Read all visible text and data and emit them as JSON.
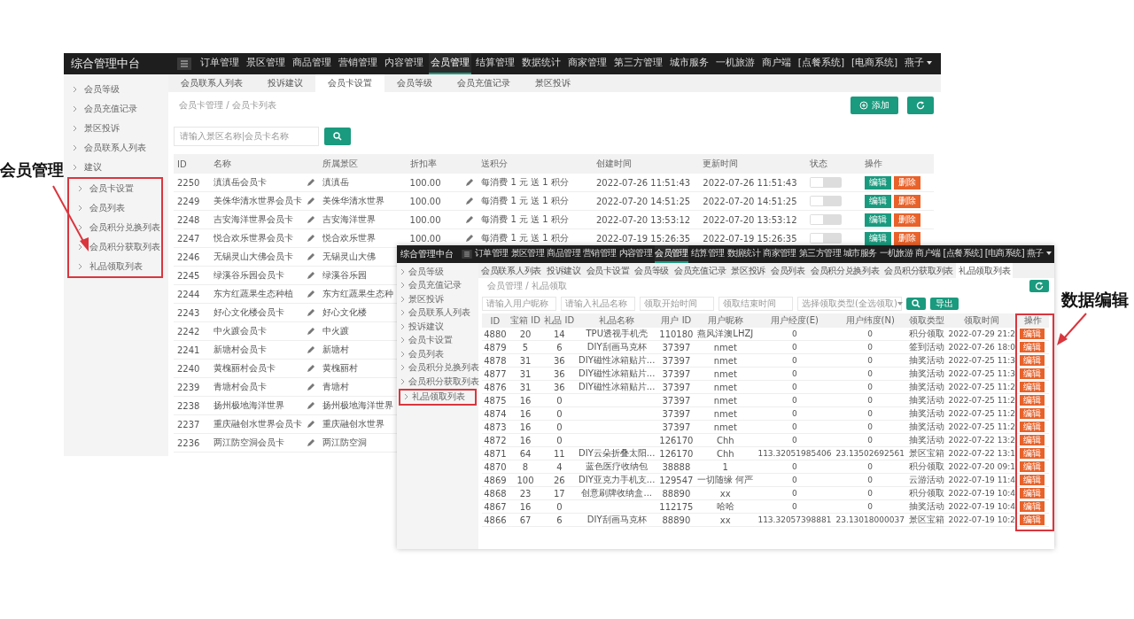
{
  "callouts": [
    {
      "text": "会员管理"
    },
    {
      "text": "数据编辑"
    }
  ],
  "back_window": {
    "title": "综合管理中台",
    "nav": [
      {
        "label": "订单管理",
        "selected": false
      },
      {
        "label": "景区管理",
        "selected": false
      },
      {
        "label": "商品管理",
        "selected": false
      },
      {
        "label": "营销管理",
        "selected": false
      },
      {
        "label": "内容管理",
        "selected": false
      },
      {
        "label": "会员管理",
        "selected": true
      },
      {
        "label": "结算管理",
        "selected": false
      },
      {
        "label": "数据统计",
        "selected": false
      },
      {
        "label": "商家管理",
        "selected": false
      },
      {
        "label": "第三方管理",
        "selected": false
      },
      {
        "label": "城市服务",
        "selected": false
      },
      {
        "label": "一机旅游",
        "selected": false
      },
      {
        "label": "商户端",
        "selected": false
      },
      {
        "label": "[点餐系统]",
        "selected": false
      },
      {
        "label": "[电商系统]",
        "selected": false
      }
    ],
    "user": "燕子",
    "tabs": [
      {
        "label": "会员联系人列表",
        "selected": false
      },
      {
        "label": "投诉建议",
        "selected": false
      },
      {
        "label": "会员卡设置",
        "selected": true
      },
      {
        "label": "会员等级",
        "selected": false
      },
      {
        "label": "会员充值记录",
        "selected": false
      },
      {
        "label": "景区投诉",
        "selected": false
      }
    ],
    "sidebar": [
      {
        "label": "会员等级",
        "boxed": false
      },
      {
        "label": "会员充值记录",
        "boxed": false
      },
      {
        "label": "景区投诉",
        "boxed": false
      },
      {
        "label": "会员联系人列表",
        "boxed": false
      },
      {
        "label": "建议",
        "boxed": false
      },
      {
        "label": "会员卡设置",
        "boxed": true
      },
      {
        "label": "会员列表",
        "boxed": true
      },
      {
        "label": "会员积分兑换列表",
        "boxed": true
      },
      {
        "label": "会员积分获取列表",
        "boxed": true
      },
      {
        "label": "礼品领取列表",
        "boxed": true
      }
    ],
    "breadcrumb": "会员卡管理 / 会员卡列表",
    "search": {
      "placeholder": "请输入景区名称|会员卡名称"
    },
    "add_button": "添加",
    "table": {
      "columns": [
        "ID",
        "名称",
        "所属景区",
        "折扣率",
        "送积分",
        "创建时间",
        "更新时间",
        "状态",
        "操作"
      ],
      "rows": [
        {
          "id": "2250",
          "name": "滇滇岳会员卡",
          "scenic": "滇滇岳",
          "discount": "100.00",
          "points": "每消费 1 元 送 1 积分",
          "created": "2022-07-26 11:51:43",
          "updated": "2022-07-26 11:51:43",
          "status": {
            "on": false
          },
          "actions": [
            "编辑",
            "删除"
          ]
        },
        {
          "id": "2249",
          "name": "美侏华清水世界会员卡",
          "scenic": "美侏华清水世界",
          "discount": "100.00",
          "points": "每消费 1 元 送 1 积分",
          "created": "2022-07-20 14:51:25",
          "updated": "2022-07-20 14:51:25",
          "status": {
            "on": false
          },
          "actions": [
            "编辑",
            "删除"
          ]
        },
        {
          "id": "2248",
          "name": "吉安海洋世界会员卡",
          "scenic": "吉安海洋世界",
          "discount": "100.00",
          "points": "每消费 1 元 送 1 积分",
          "created": "2022-07-20 13:53:12",
          "updated": "2022-07-20 13:53:12",
          "status": {
            "on": false
          },
          "actions": [
            "编辑",
            "删除"
          ]
        },
        {
          "id": "2247",
          "name": "悦合欢乐世界会员卡",
          "scenic": "悦合欢乐世界",
          "discount": "100.00",
          "points": "每消费 1 元 送 1 积分",
          "created": "2022-07-19 15:26:35",
          "updated": "2022-07-19 15:26:35",
          "status": {
            "on": false
          },
          "actions": [
            "编辑",
            "删除"
          ]
        },
        {
          "id": "2246",
          "name": "无锡灵山大佛会员卡",
          "scenic": "无锡灵山大佛"
        },
        {
          "id": "2245",
          "name": "绿溪谷乐园会员卡",
          "scenic": "绿溪谷乐园"
        },
        {
          "id": "2244",
          "name": "东方红蔬果生态种植",
          "scenic": "东方红蔬果生态种"
        },
        {
          "id": "2243",
          "name": "好心文化楼会员卡",
          "scenic": "好心文化楼"
        },
        {
          "id": "2242",
          "name": "中火踱会员卡",
          "scenic": "中火踱"
        },
        {
          "id": "2241",
          "name": "新塘村会员卡",
          "scenic": "新塘村"
        },
        {
          "id": "2240",
          "name": "黄槐丽村会员卡",
          "scenic": "黄槐丽村"
        },
        {
          "id": "2239",
          "name": "青塘村会员卡",
          "scenic": "青塘村"
        },
        {
          "id": "2238",
          "name": "扬州极地海洋世界",
          "scenic": "扬州极地海洋世界"
        },
        {
          "id": "2237",
          "name": "重庆融创水世界会员卡",
          "scenic": "重庆融创水世界"
        },
        {
          "id": "2236",
          "name": "两江防空洞会员卡",
          "scenic": "两江防空洞"
        }
      ]
    }
  },
  "front_window": {
    "title": "综合管理中台",
    "nav": [
      {
        "label": "订单管理",
        "selected": false
      },
      {
        "label": "景区管理",
        "selected": false
      },
      {
        "label": "商品管理",
        "selected": false
      },
      {
        "label": "营销管理",
        "selected": false
      },
      {
        "label": "内容管理",
        "selected": false
      },
      {
        "label": "会员管理",
        "selected": true
      },
      {
        "label": "结算管理",
        "selected": false
      },
      {
        "label": "数据统计",
        "selected": false
      },
      {
        "label": "商家管理",
        "selected": false
      },
      {
        "label": "第三方管理",
        "selected": false
      },
      {
        "label": "城市服务",
        "selected": false
      },
      {
        "label": "一机旅游",
        "selected": false
      },
      {
        "label": "商户端",
        "selected": false
      },
      {
        "label": "[点餐系统]",
        "selected": false
      },
      {
        "label": "[电商系统]",
        "selected": false
      }
    ],
    "user": "燕子",
    "tabs": [
      {
        "label": "会员联系人列表",
        "selected": false
      },
      {
        "label": "投诉建议",
        "selected": false
      },
      {
        "label": "会员卡设置",
        "selected": false
      },
      {
        "label": "会员等级",
        "selected": false
      },
      {
        "label": "会员充值记录",
        "selected": false
      },
      {
        "label": "景区投诉",
        "selected": false
      },
      {
        "label": "会员列表",
        "selected": false
      },
      {
        "label": "会员积分兑换列表",
        "selected": false
      },
      {
        "label": "会员积分获取列表",
        "selected": false
      },
      {
        "label": "礼品领取列表",
        "selected": true
      }
    ],
    "sidebar": [
      {
        "label": "会员等级",
        "boxed": false
      },
      {
        "label": "会员充值记录",
        "boxed": false
      },
      {
        "label": "景区投诉",
        "boxed": false
      },
      {
        "label": "会员联系人列表",
        "boxed": false
      },
      {
        "label": "投诉建议",
        "boxed": false
      },
      {
        "label": "会员卡设置",
        "boxed": false
      },
      {
        "label": "会员列表",
        "boxed": false
      },
      {
        "label": "会员积分兑换列表",
        "boxed": false
      },
      {
        "label": "会员积分获取列表",
        "boxed": false
      },
      {
        "label": "礼品领取列表",
        "boxed": true
      }
    ],
    "breadcrumb": "会员管理 / 礼品领取",
    "filters": [
      {
        "placeholder": "请输入用户昵称"
      },
      {
        "placeholder": "请输入礼品名称"
      },
      {
        "placeholder": "领取开始时间"
      },
      {
        "placeholder": "领取结束时间"
      }
    ],
    "type_select": "选择领取类型(全选领取)",
    "export_button": "导出",
    "table": {
      "columns": [
        "ID",
        "宝箱 ID",
        "礼品 ID",
        "礼品名称",
        "用户 ID",
        "用户昵称",
        "用户经度(E)",
        "用户纬度(N)",
        "领取类型",
        "领取时间",
        "操作"
      ],
      "rows": [
        {
          "id": "4880",
          "box_id": "20",
          "gift_id": "14",
          "gift_name": "TPU透视手机壳",
          "user_id": "110180",
          "nickname": "燕风洋澳LHZJ",
          "lng": "0",
          "lat": "0",
          "type": "积分领取",
          "time": "2022-07-29 21:2",
          "action": "编辑"
        },
        {
          "id": "4879",
          "box_id": "5",
          "gift_id": "6",
          "gift_name": "DIY刮画马克杯",
          "user_id": "37397",
          "nickname": "nmet",
          "lng": "0",
          "lat": "0",
          "type": "签到活动",
          "time": "2022-07-26 18:0",
          "action": "编辑"
        },
        {
          "id": "4878",
          "box_id": "31",
          "gift_id": "36",
          "gift_name": "DIY磁性冰箱贴片...",
          "user_id": "37397",
          "nickname": "nmet",
          "lng": "0",
          "lat": "0",
          "type": "抽奖活动",
          "time": "2022-07-25 11:3",
          "action": "编辑"
        },
        {
          "id": "4877",
          "box_id": "31",
          "gift_id": "36",
          "gift_name": "DIY磁性冰箱贴片...",
          "user_id": "37397",
          "nickname": "nmet",
          "lng": "0",
          "lat": "0",
          "type": "抽奖活动",
          "time": "2022-07-25 11:3",
          "action": "编辑"
        },
        {
          "id": "4876",
          "box_id": "31",
          "gift_id": "36",
          "gift_name": "DIY磁性冰箱贴片...",
          "user_id": "37397",
          "nickname": "nmet",
          "lng": "0",
          "lat": "0",
          "type": "抽奖活动",
          "time": "2022-07-25 11:2",
          "action": "编辑"
        },
        {
          "id": "4875",
          "box_id": "16",
          "gift_id": "0",
          "user_id": "37397",
          "nickname": "nmet",
          "lng": "0",
          "lat": "0",
          "type": "抽奖活动",
          "time": "2022-07-25 11:2",
          "action": "编辑"
        },
        {
          "id": "4874",
          "box_id": "16",
          "gift_id": "0",
          "user_id": "37397",
          "nickname": "nmet",
          "lng": "0",
          "lat": "0",
          "type": "抽奖活动",
          "time": "2022-07-25 11:2",
          "action": "编辑"
        },
        {
          "id": "4873",
          "box_id": "16",
          "gift_id": "0",
          "user_id": "37397",
          "nickname": "nmet",
          "lng": "0",
          "lat": "0",
          "type": "抽奖活动",
          "time": "2022-07-25 11:2",
          "action": "编辑"
        },
        {
          "id": "4872",
          "box_id": "16",
          "gift_id": "0",
          "user_id": "126170",
          "nickname": "Chh",
          "lng": "0",
          "lat": "0",
          "type": "抽奖活动",
          "time": "2022-07-22 13:2",
          "action": "编辑"
        },
        {
          "id": "4871",
          "box_id": "64",
          "gift_id": "11",
          "gift_name": "DIY云朵折叠太阳...",
          "user_id": "126170",
          "nickname": "Chh",
          "lng": "113.32051985406",
          "lat": "23.13502692561",
          "type": "景区宝箱",
          "time": "2022-07-22 13:1",
          "action": "编辑"
        },
        {
          "id": "4870",
          "box_id": "8",
          "gift_id": "4",
          "gift_name": "蓝色医疗收纳包",
          "user_id": "38888",
          "nickname": "1",
          "lng": "0",
          "lat": "0",
          "type": "积分领取",
          "time": "2022-07-20 09:1",
          "action": "编辑"
        },
        {
          "id": "4869",
          "box_id": "100",
          "gift_id": "26",
          "gift_name": "DIY亚克力手机支...",
          "user_id": "129547",
          "nickname": "一切随缘 何严",
          "lng": "0",
          "lat": "0",
          "type": "云游活动",
          "time": "2022-07-19 11:4",
          "action": "编辑"
        },
        {
          "id": "4868",
          "box_id": "23",
          "gift_id": "17",
          "gift_name": "创意刷牌收纳盒...",
          "user_id": "88890",
          "nickname": "xx",
          "lng": "0",
          "lat": "0",
          "type": "积分领取",
          "time": "2022-07-19 10:4",
          "action": "编辑"
        },
        {
          "id": "4867",
          "box_id": "16",
          "gift_id": "0",
          "user_id": "112175",
          "nickname": "哈哈",
          "lng": "0",
          "lat": "0",
          "type": "抽奖活动",
          "time": "2022-07-19 10:4",
          "action": "编辑"
        },
        {
          "id": "4866",
          "box_id": "67",
          "gift_id": "6",
          "gift_name": "DIY刮画马克杯",
          "user_id": "88890",
          "nickname": "xx",
          "lng": "113.32057398881",
          "lat": "23.13018000037",
          "type": "景区宝箱",
          "time": "2022-07-19 10:2",
          "action": "编辑"
        }
      ]
    }
  }
}
